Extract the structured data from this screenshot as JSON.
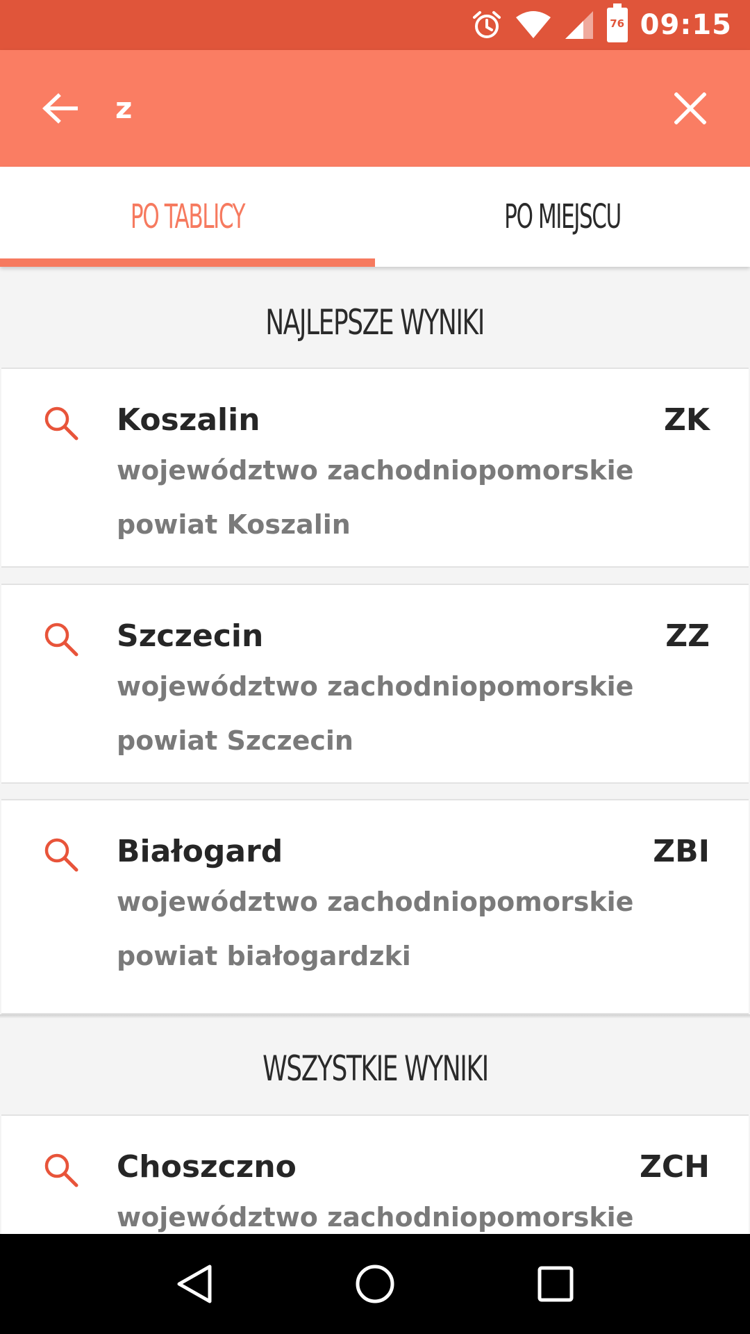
{
  "status_bar": {
    "time": "09:15",
    "battery_level": "76",
    "icons": [
      "alarm-icon",
      "wifi-icon",
      "signal-icon",
      "battery-icon"
    ]
  },
  "search": {
    "query": "z"
  },
  "tabs": [
    {
      "label": "PO TABLICY",
      "active": true
    },
    {
      "label": "PO MIEJSCU",
      "active": false
    }
  ],
  "sections": {
    "best": {
      "title": "NAJLEPSZE WYNIKI",
      "results": [
        {
          "city": "Koszalin",
          "code": "ZK",
          "region": "województwo zachodniopomorskie",
          "county": "powiat Koszalin"
        },
        {
          "city": "Szczecin",
          "code": "ZZ",
          "region": "województwo zachodniopomorskie",
          "county": "powiat Szczecin"
        },
        {
          "city": "Białogard",
          "code": "ZBI",
          "region": "województwo zachodniopomorskie",
          "county": "powiat białogardzki"
        }
      ]
    },
    "all": {
      "title": "WSZYSTKIE WYNIKI",
      "results": [
        {
          "city": "Choszczno",
          "code": "ZCH",
          "region": "województwo zachodniopomorskie"
        }
      ]
    }
  },
  "colors": {
    "status_bar": "#e0553a",
    "app_bar": "#fa7d63",
    "accent": "#f67a5f",
    "icon": "#e8543a"
  }
}
